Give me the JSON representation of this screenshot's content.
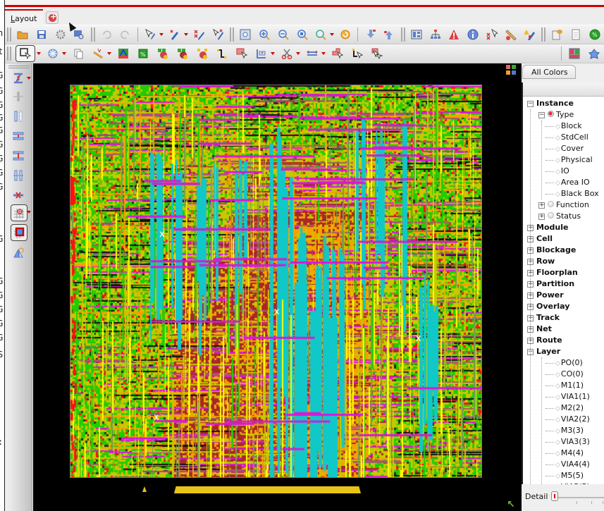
{
  "window": {
    "tabs": [
      {
        "label": "Layout",
        "mnemonic": "L",
        "active": true
      }
    ],
    "add_tab_icon": "add-tab-icon"
  },
  "background_window": {
    "edge_chars": [
      "n",
      "t",
      "G",
      "G",
      "G",
      "G",
      "G",
      "G",
      "G",
      "G",
      "G",
      "G",
      "G",
      "G",
      "G",
      "G",
      "G",
      "S",
      ":"
    ]
  },
  "toolbar_main": {
    "groups": [
      [
        "open-folder-icon",
        "save-icon",
        "settings-gear-icon",
        "window-search-icon"
      ],
      [
        "undo-icon",
        "redo-icon"
      ],
      [
        "select-edit-icon",
        "edit-wire-icon",
        "delete-wire-icon",
        "deselect-wire-icon"
      ],
      [
        "zoom-fit-icon",
        "zoom-in-icon",
        "zoom-out-icon",
        "zoom-selected-icon",
        "zoom-previous-icon",
        "refresh-icon"
      ],
      [
        "hierarchy-down-icon",
        "hierarchy-up-icon"
      ],
      [
        "panel-layout-icon",
        "tree-icon",
        "warning-icon",
        "info-icon",
        "select-marker-icon",
        "ruler-icon",
        "violation-icon"
      ],
      [
        "report-icon",
        "notepad-icon",
        "green-status-icon"
      ]
    ]
  },
  "toolbar_edit": {
    "items": [
      "select-box-icon",
      "snowflake-icon",
      "copy-icon",
      "ruler-flag-icon",
      "timing-icon",
      "percent-icon",
      "add-instance-icon",
      "add-cell-icon",
      "add-group-icon",
      "route-step-icon",
      "select-area-icon",
      "stretch-icon",
      "cut-icon",
      "move-icon",
      "select-shape-icon",
      "select-wire-icon",
      "select-group-icon"
    ],
    "right_items": [
      "layer-panel-icon",
      "net-icon"
    ]
  },
  "vertical_toolbar": {
    "items": [
      "align-vertical-icon",
      "spacing-horizontal-icon",
      "distribute-icon",
      "align-center-icon",
      "align-middle-icon",
      "space-even-icon",
      "delete-align-icon",
      "snap-grid-icon",
      "place-block-icon",
      "flip-rotate-icon"
    ]
  },
  "layout_view": {
    "background": "#000000",
    "layer_colors": {
      "green": "#22cc00",
      "yellow_green": "#c8c800",
      "dark_red": "#a82828",
      "orange": "#f5a000",
      "cyan": "#10c8c8",
      "magenta": "#d818d8",
      "yellow": "#ffff00",
      "red": "#ff1010"
    },
    "markers": [
      "x",
      "x",
      "x",
      "x"
    ]
  },
  "right_panel": {
    "all_colors_label": "All Colors",
    "tree": [
      {
        "label": "Instance",
        "bold": true,
        "expander": "minus",
        "level": 0
      },
      {
        "label": "Type",
        "bold": false,
        "expander": "minus",
        "radio": "on",
        "level": 1
      },
      {
        "label": "Block",
        "level": 2,
        "leaf": true
      },
      {
        "label": "StdCell",
        "level": 2,
        "leaf": true
      },
      {
        "label": "Cover",
        "level": 2,
        "leaf": true
      },
      {
        "label": "Physical",
        "level": 2,
        "leaf": true
      },
      {
        "label": "IO",
        "level": 2,
        "leaf": true
      },
      {
        "label": "Area IO",
        "level": 2,
        "leaf": true
      },
      {
        "label": "Black Box",
        "level": 2,
        "leaf": true
      },
      {
        "label": "Function",
        "expander": "plus",
        "radio": "off",
        "level": 1
      },
      {
        "label": "Status",
        "expander": "plus",
        "radio": "off",
        "level": 1
      },
      {
        "label": "Module",
        "bold": true,
        "expander": "plus",
        "level": 0
      },
      {
        "label": "Cell",
        "bold": true,
        "expander": "plus",
        "level": 0
      },
      {
        "label": "Blockage",
        "bold": true,
        "expander": "plus",
        "level": 0
      },
      {
        "label": "Row",
        "bold": true,
        "expander": "plus",
        "level": 0
      },
      {
        "label": "Floorplan",
        "bold": true,
        "expander": "plus",
        "level": 0
      },
      {
        "label": "Partition",
        "bold": true,
        "expander": "plus",
        "level": 0
      },
      {
        "label": "Power",
        "bold": true,
        "expander": "plus",
        "level": 0
      },
      {
        "label": "Overlay",
        "bold": true,
        "expander": "plus",
        "level": 0
      },
      {
        "label": "Track",
        "bold": true,
        "expander": "plus",
        "level": 0
      },
      {
        "label": "Net",
        "bold": true,
        "expander": "plus",
        "level": 0
      },
      {
        "label": "Route",
        "bold": true,
        "expander": "plus",
        "level": 0
      },
      {
        "label": "Layer",
        "bold": true,
        "expander": "minus",
        "level": 0
      },
      {
        "label": "PO(0)",
        "level": 2,
        "leaf": true
      },
      {
        "label": "CO(0)",
        "level": 2,
        "leaf": true
      },
      {
        "label": "M1(1)",
        "level": 2,
        "leaf": true
      },
      {
        "label": "VIA1(1)",
        "level": 2,
        "leaf": true
      },
      {
        "label": "M2(2)",
        "level": 2,
        "leaf": true
      },
      {
        "label": "VIA2(2)",
        "level": 2,
        "leaf": true
      },
      {
        "label": "M3(3)",
        "level": 2,
        "leaf": true
      },
      {
        "label": "VIA3(3)",
        "level": 2,
        "leaf": true
      },
      {
        "label": "M4(4)",
        "level": 2,
        "leaf": true
      },
      {
        "label": "VIA4(4)",
        "level": 2,
        "leaf": true
      },
      {
        "label": "M5(5)",
        "level": 2,
        "leaf": true
      },
      {
        "label": "VIA5(5)",
        "level": 2,
        "leaf": true
      }
    ],
    "detail_label": "Detail",
    "detail_level": 0
  }
}
